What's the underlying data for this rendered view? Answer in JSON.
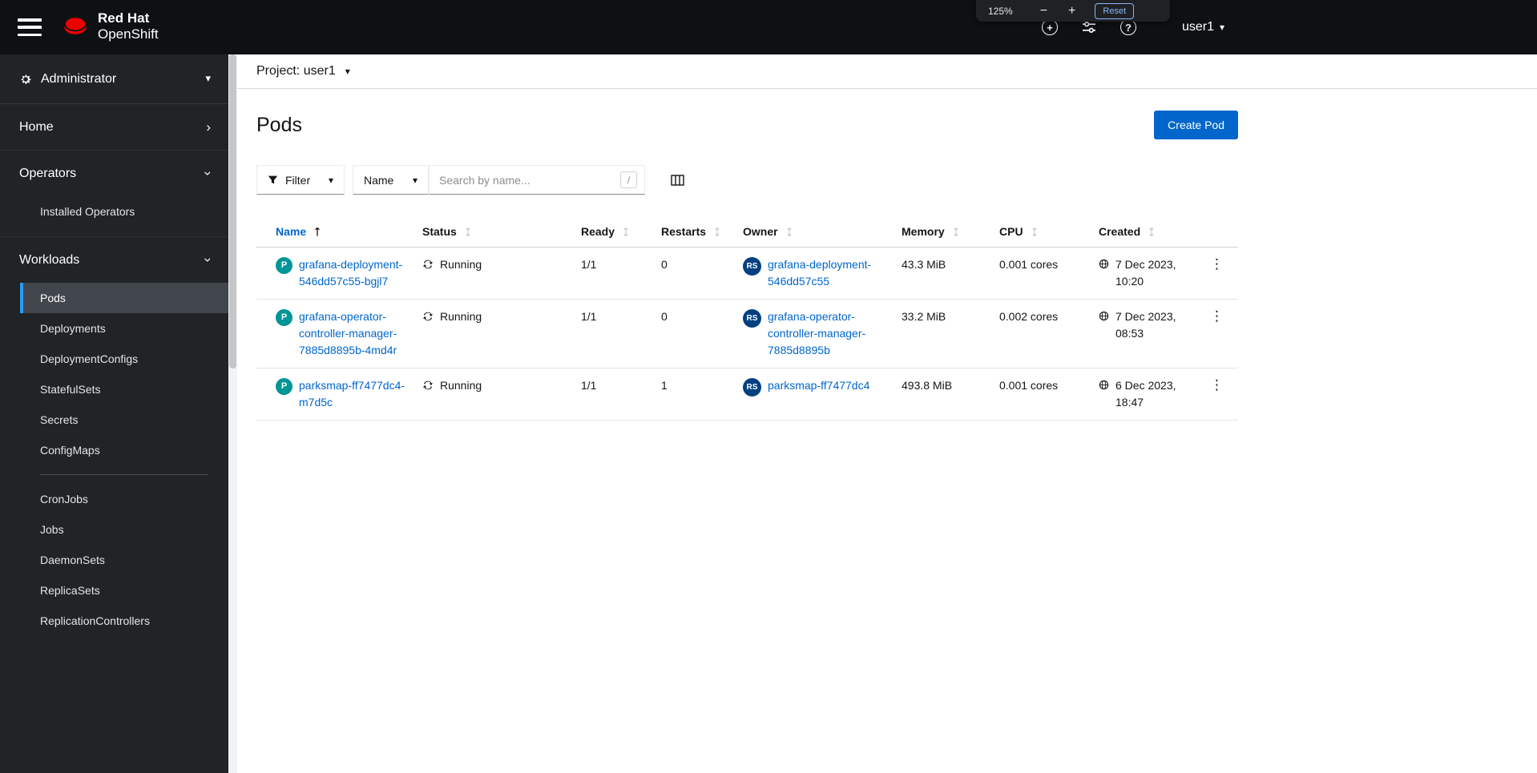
{
  "icons": {
    "caret_down": "▾",
    "chevron": "›",
    "kebab": "⋮",
    "plus": "+",
    "question": "?"
  },
  "masthead": {
    "brand": {
      "line1": "Red Hat",
      "line2": "OpenShift"
    },
    "zoom_popup": {
      "level": "125%",
      "minus_label": "−",
      "plus_label": "+",
      "reset_label": "Reset"
    },
    "username": "user1"
  },
  "sidebar": {
    "perspective_label": "Administrator",
    "sections": {
      "home": {
        "label": "Home"
      },
      "operators": {
        "label": "Operators",
        "items": [
          "Installed Operators"
        ]
      },
      "workloads": {
        "label": "Workloads",
        "items_top": [
          "Pods",
          "Deployments",
          "DeploymentConfigs",
          "StatefulSets",
          "Secrets",
          "ConfigMaps"
        ],
        "items_bottom": [
          "CronJobs",
          "Jobs",
          "DaemonSets",
          "ReplicaSets",
          "ReplicationControllers"
        ],
        "selected_item": "Pods"
      }
    }
  },
  "project_bar": {
    "label": "Project: user1"
  },
  "page_header": {
    "title": "Pods",
    "create_button_label": "Create Pod"
  },
  "toolbar": {
    "filter_label": "Filter",
    "attribute_label": "Name",
    "search_placeholder": "Search by name...",
    "search_shortcut": "/"
  },
  "table": {
    "columns": {
      "name": "Name",
      "status": "Status",
      "ready": "Ready",
      "restarts": "Restarts",
      "owner": "Owner",
      "memory": "Memory",
      "cpu": "CPU",
      "created": "Created"
    },
    "sort": {
      "column": "Name",
      "direction": "ascending"
    },
    "pod_badge": "P",
    "owner_badge": "RS",
    "rows": [
      {
        "name": "grafana-deployment-546dd57c55-bgjl7",
        "status": "Running",
        "ready": "1/1",
        "restarts": "0",
        "owner": "grafana-deployment-546dd57c55",
        "memory": "43.3 MiB",
        "cpu": "0.001 cores",
        "created": "7 Dec 2023, 10:20"
      },
      {
        "name": "grafana-operator-controller-manager-7885d8895b-4md4r",
        "status": "Running",
        "ready": "1/1",
        "restarts": "0",
        "owner": "grafana-operator-controller-manager-7885d8895b",
        "memory": "33.2 MiB",
        "cpu": "0.002 cores",
        "created": "7 Dec 2023, 08:53"
      },
      {
        "name": "parksmap-ff7477dc4-m7d5c",
        "status": "Running",
        "ready": "1/1",
        "restarts": "1",
        "owner": "parksmap-ff7477dc4",
        "memory": "493.8 MiB",
        "cpu": "0.001 cores",
        "created": "6 Dec 2023, 18:47"
      }
    ]
  },
  "colors": {
    "accent_blue": "#0066cc",
    "link_blue": "#0066cc",
    "pod_badge_teal": "#009596",
    "replicaset_badge_blue": "#004080",
    "masthead_black": "#0e1114",
    "sidebar_dark": "#212427",
    "nav_selected_border": "#2b9af3",
    "brand_red": "#ee0000"
  }
}
